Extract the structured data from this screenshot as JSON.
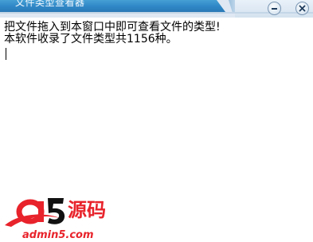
{
  "window": {
    "title": "文件类型查看器",
    "minimize_icon": "minimize-icon",
    "close_icon": "close-icon"
  },
  "content": {
    "lines": [
      "把文件拖入到本窗口中即可查看文件的类型!",
      "本软件收录了文件类型共1156种。"
    ]
  },
  "watermark": {
    "brand_chars": "源码",
    "url": "admin5.com",
    "colors": {
      "red": "#e8232b",
      "black": "#111111"
    }
  },
  "colors": {
    "title_blue": "#2f86c6",
    "title_light": "#dfe8f3",
    "background": "#ffffff"
  }
}
